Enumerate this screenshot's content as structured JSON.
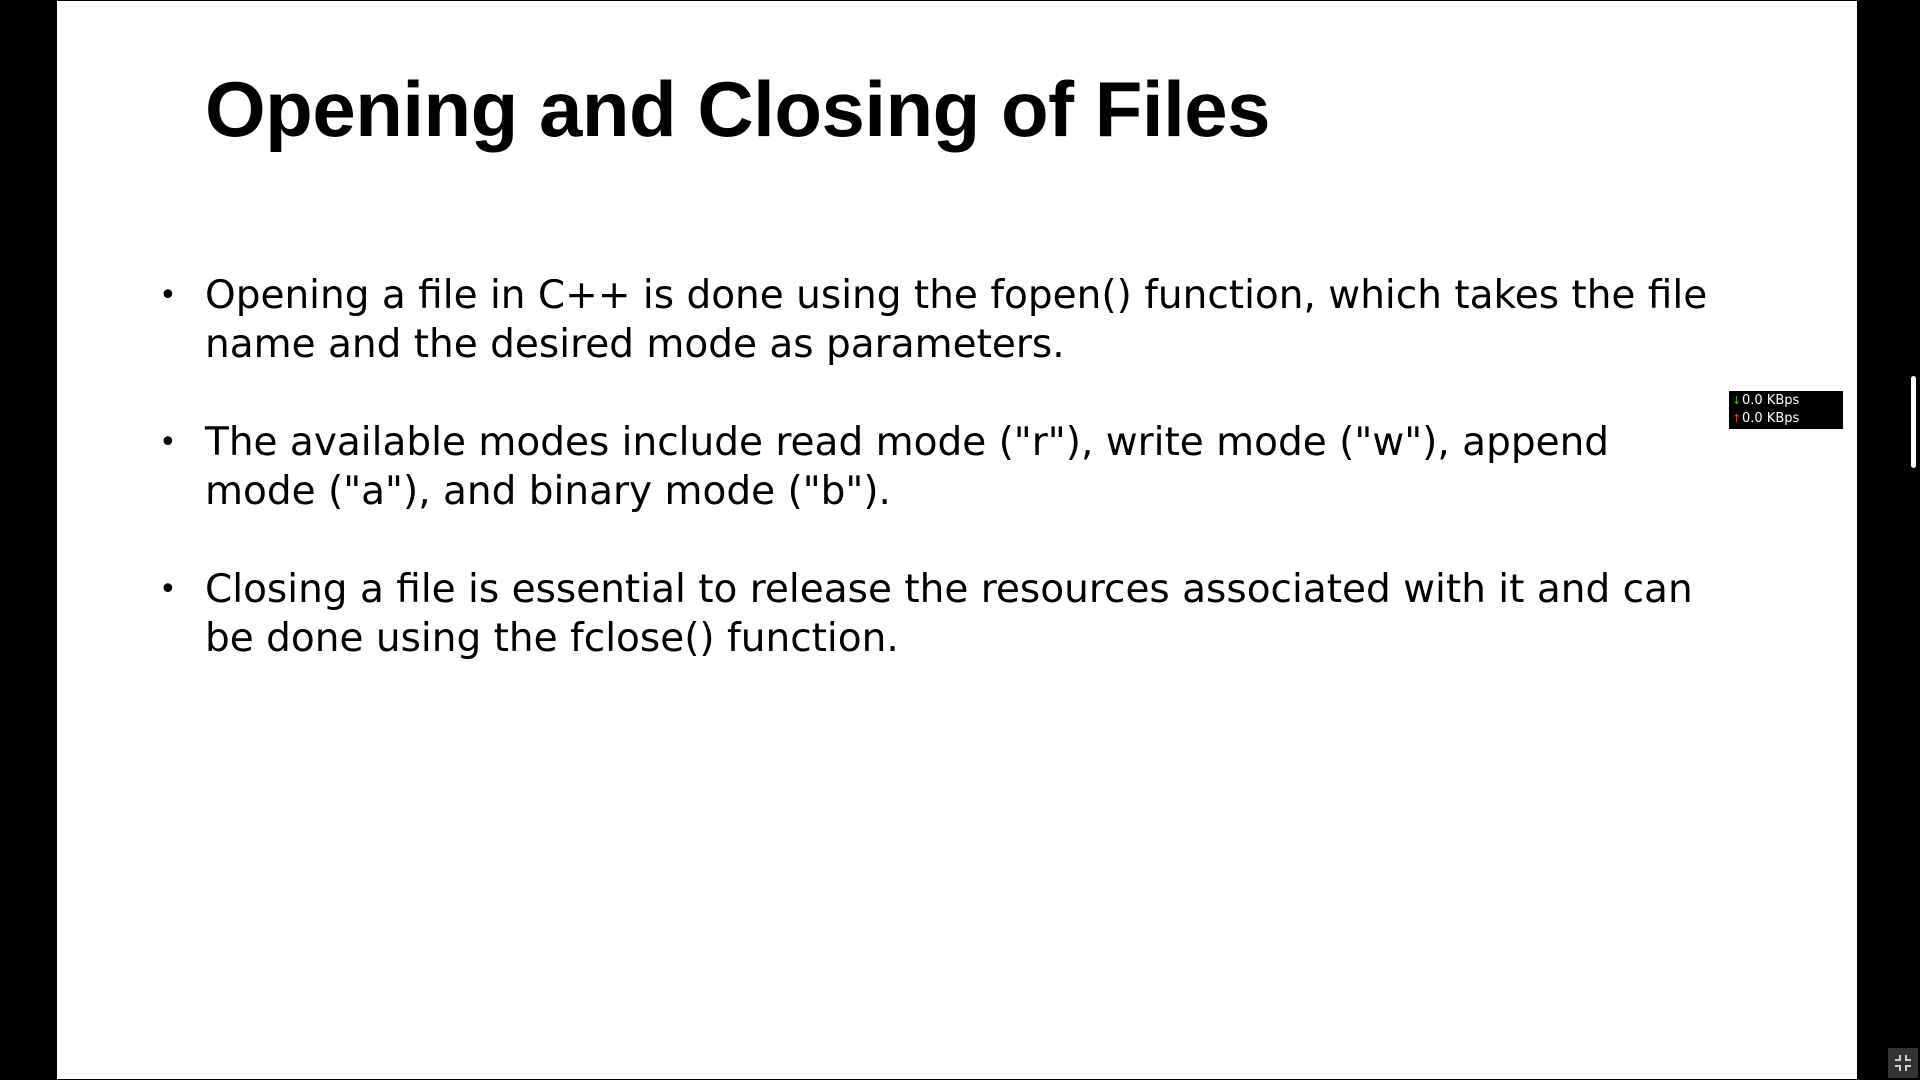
{
  "slide": {
    "title": "Opening and Closing of Files",
    "bullets": [
      "Opening a file in C++ is done using the fopen() function, which takes the file name and the desired mode as parameters.",
      "The available modes include read mode (\"r\"), write mode (\"w\"), append mode (\"a\"), and binary mode (\"b\").",
      "Closing a file is essential to release the resources associated with it and can be done using the fclose() function."
    ],
    "bullet_symbol": "•"
  },
  "network_meter": {
    "download": "0.0 KBps",
    "upload": "0.0 KBps",
    "download_icon": "download-arrow-icon",
    "upload_icon": "upload-arrow-icon",
    "download_color": "#4caf50",
    "upload_color": "#e53935"
  },
  "controls": {
    "exit_fullscreen_icon": "exit-fullscreen-icon"
  }
}
